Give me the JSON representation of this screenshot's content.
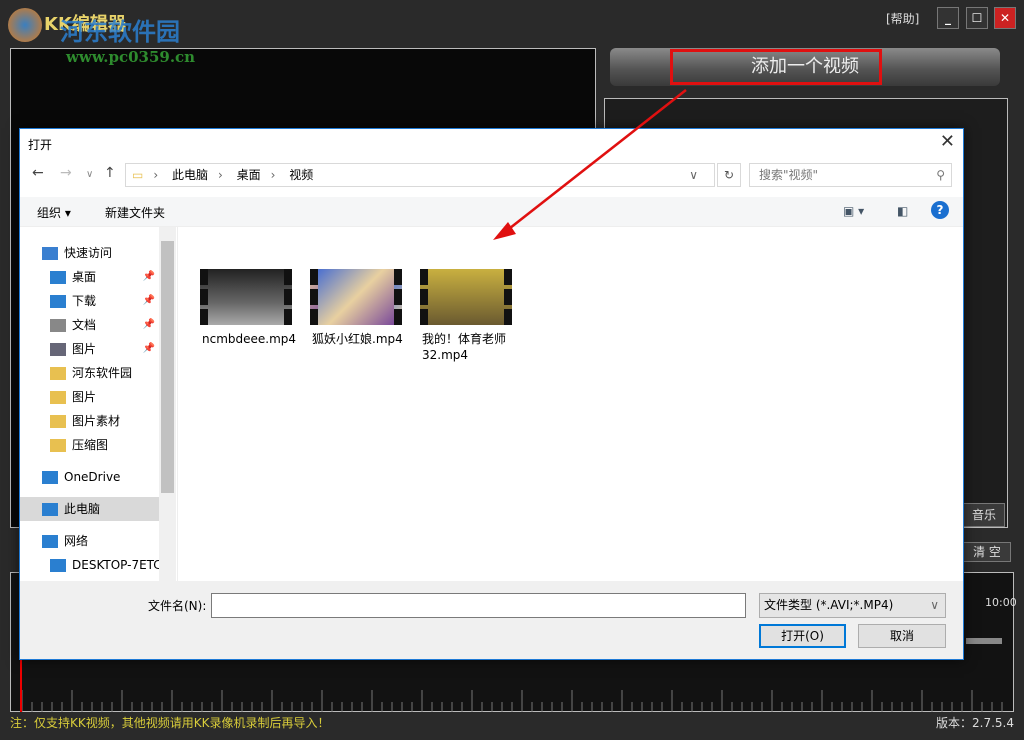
{
  "app": {
    "title": "KK编辑器",
    "help": "[帮助]",
    "add_video": "添加一个视频",
    "music_btn": "音乐",
    "clear_btn": "清 空",
    "timeline_label": "10:00",
    "note": "注：仅支持KK视频，其他视频请用KK录像机录制后再导入！",
    "version": "版本：2.7.5.4"
  },
  "watermark": {
    "name": "河东软件园",
    "url": "www.pc0359.cn"
  },
  "dialog": {
    "title": "打开",
    "breadcrumb": [
      "此电脑",
      "桌面",
      "视频"
    ],
    "search_placeholder": "搜索\"视频\"",
    "organize": "组织 ▾",
    "new_folder": "新建文件夹",
    "nav": [
      {
        "label": "快速访问"
      },
      {
        "label": "桌面"
      },
      {
        "label": "下载"
      },
      {
        "label": "文档"
      },
      {
        "label": "图片"
      },
      {
        "label": "河东软件园"
      },
      {
        "label": "图片"
      },
      {
        "label": "图片素材"
      },
      {
        "label": "压缩图"
      },
      {
        "label": "OneDrive"
      },
      {
        "label": "此电脑"
      },
      {
        "label": "网络"
      },
      {
        "label": "DESKTOP-7ETC"
      }
    ],
    "files": [
      {
        "name": "ncmbdeee.mp4"
      },
      {
        "name": "狐妖小红娘.mp4"
      },
      {
        "name": "我的！体育老师32.mp4"
      }
    ],
    "filename_label": "文件名(N):",
    "filename_value": "",
    "filetype": "文件类型 (*.AVI;*.MP4)",
    "open": "打开(O)",
    "cancel": "取消"
  },
  "colors": {
    "accent": "#0078d7",
    "highlight": "#e01010",
    "note": "#d8cc3a"
  }
}
